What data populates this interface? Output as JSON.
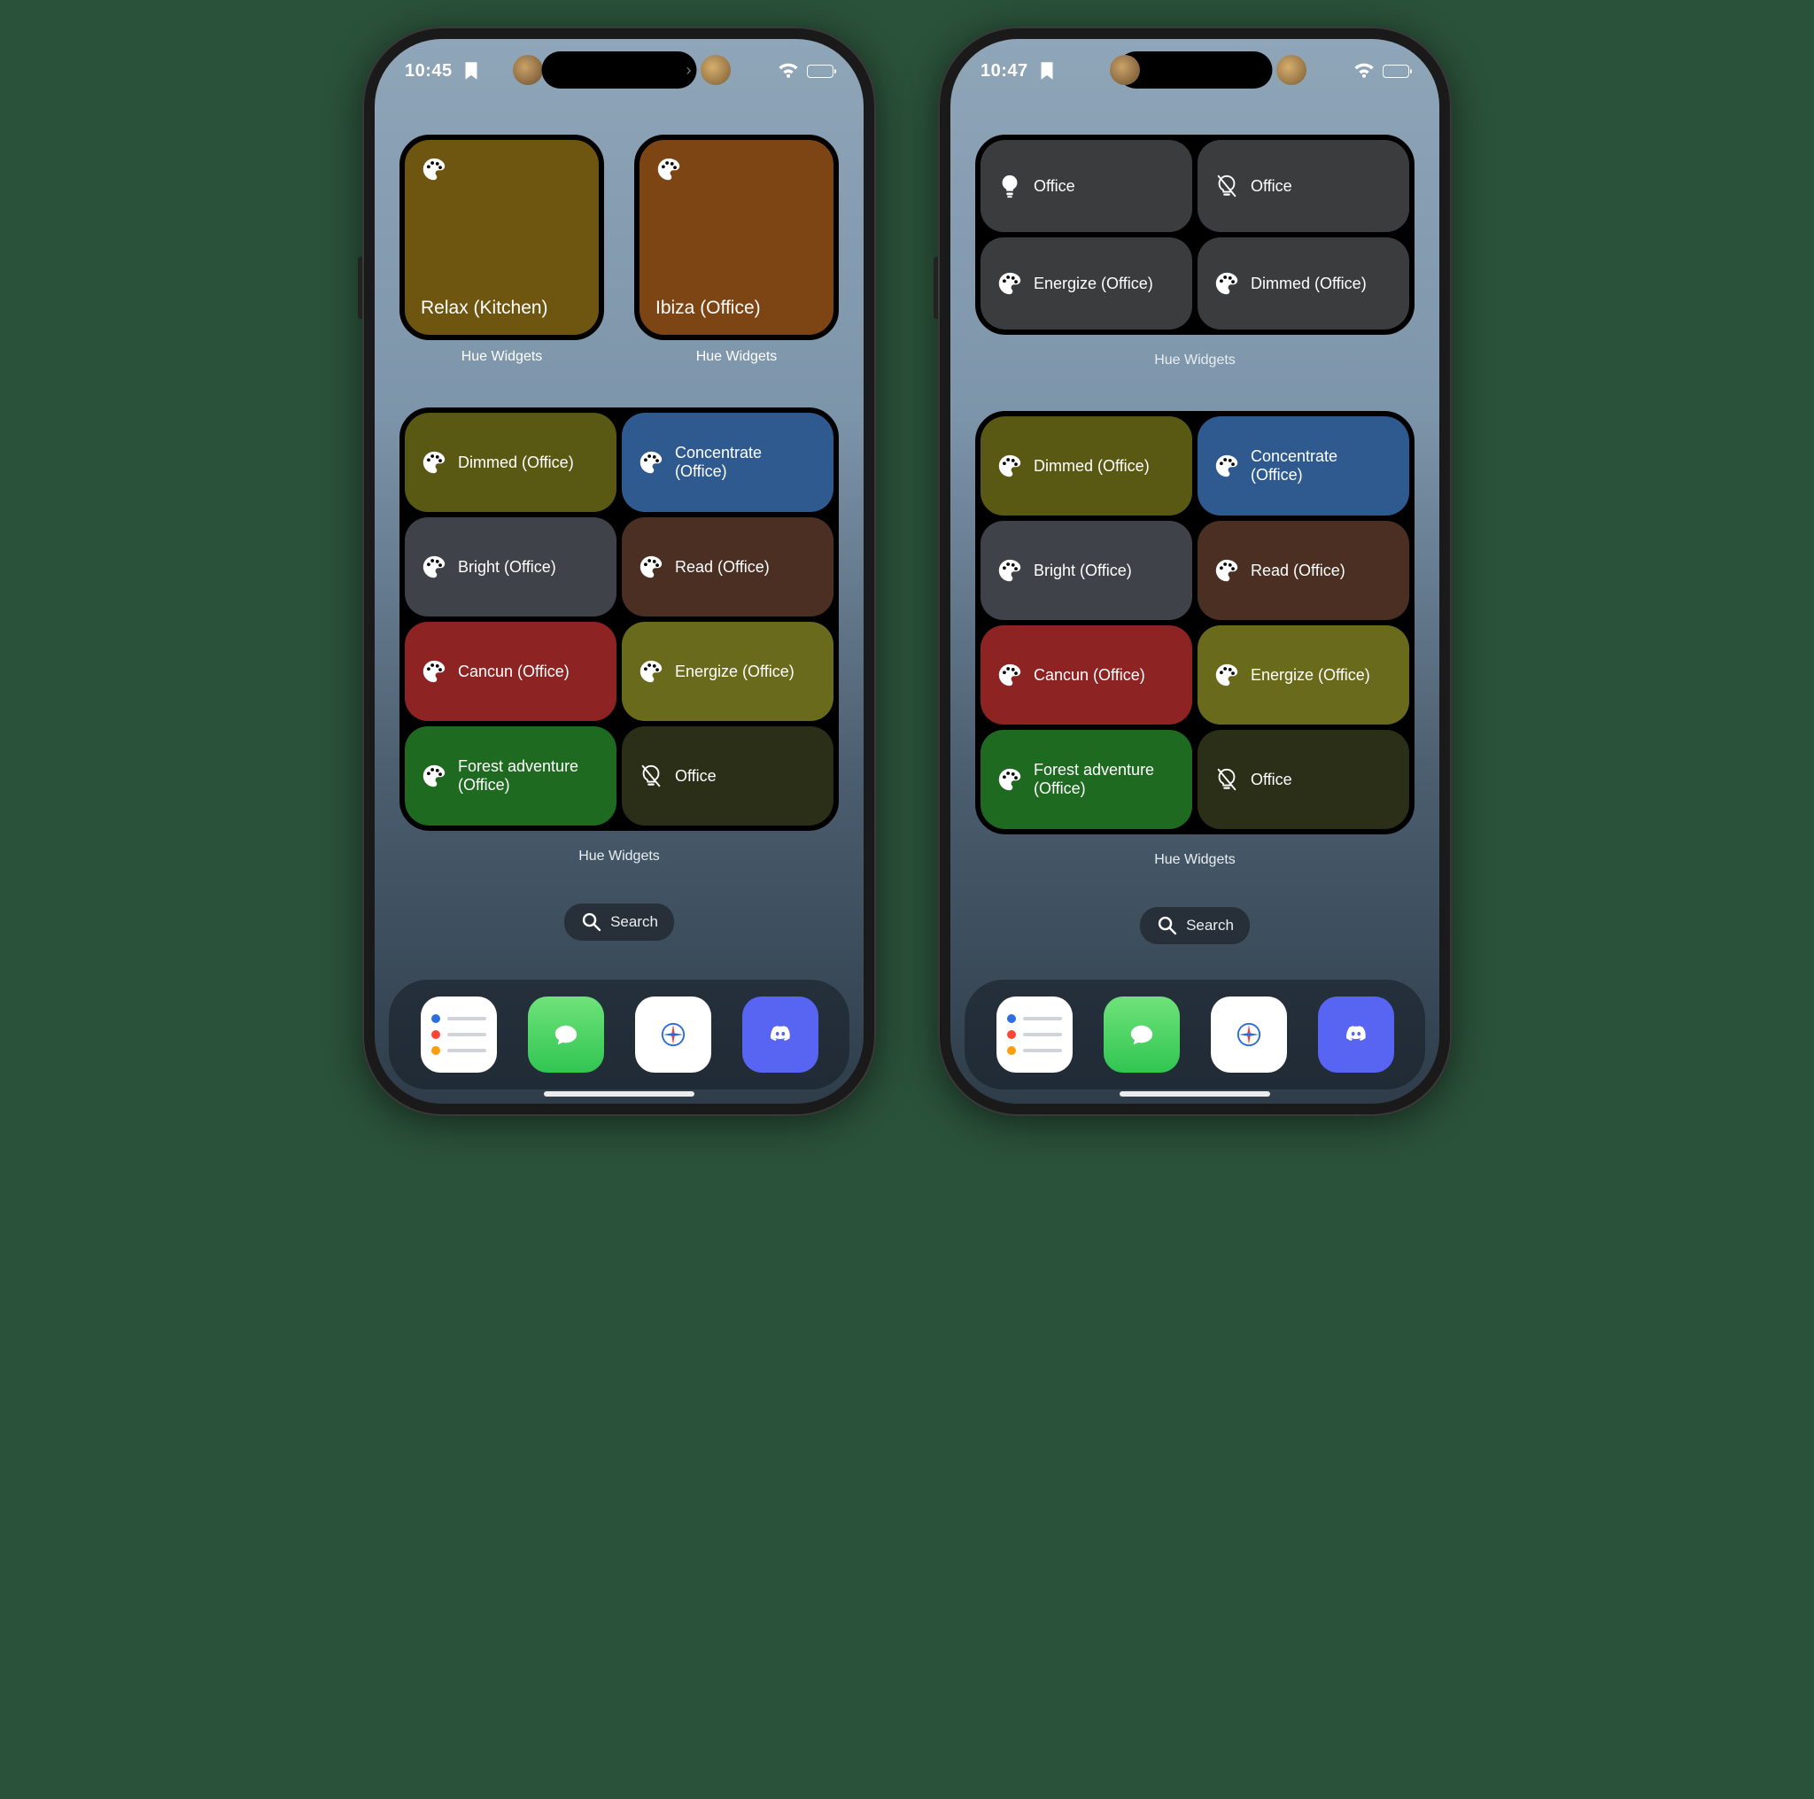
{
  "phones": {
    "left": {
      "time": "10:45",
      "small_widgets": [
        {
          "label": "Relax (Kitchen)",
          "bg": "#6f5610",
          "caption": "Hue Widgets"
        },
        {
          "label": "Ibiza (Office)",
          "bg": "#7c4513",
          "caption": "Hue Widgets"
        }
      ],
      "big_caption": "Hue Widgets"
    },
    "right": {
      "time": "10:47",
      "mid_cells": [
        {
          "icon": "bulb-on",
          "label": "Office"
        },
        {
          "icon": "bulb-off",
          "label": "Office"
        },
        {
          "icon": "palette",
          "label": "Energize (Office)"
        },
        {
          "icon": "palette",
          "label": "Dimmed (Office)"
        }
      ],
      "mid_caption": "Hue Widgets",
      "big_caption": "Hue Widgets"
    }
  },
  "big_grid": [
    {
      "icon": "palette",
      "label": "Dimmed (Office)",
      "bg": "#5a5914"
    },
    {
      "icon": "palette",
      "label": "Concentrate (Office)",
      "bg": "#2f5a90"
    },
    {
      "icon": "palette",
      "label": "Bright (Office)",
      "bg": "#3f4249"
    },
    {
      "icon": "palette",
      "label": "Read (Office)",
      "bg": "#4a2f22"
    },
    {
      "icon": "palette",
      "label": "Cancun (Office)",
      "bg": "#8e2324"
    },
    {
      "icon": "palette",
      "label": "Energize (Office)",
      "bg": "#6a6a1d"
    },
    {
      "icon": "palette",
      "label": "Forest adventure (Office)",
      "bg": "#1f6a21"
    },
    {
      "icon": "bulb-off",
      "label": "Office",
      "bg": "#2c2f17"
    }
  ],
  "search_label": "Search",
  "dock": {
    "apps": [
      "reminders",
      "messages",
      "safari",
      "discord"
    ]
  }
}
